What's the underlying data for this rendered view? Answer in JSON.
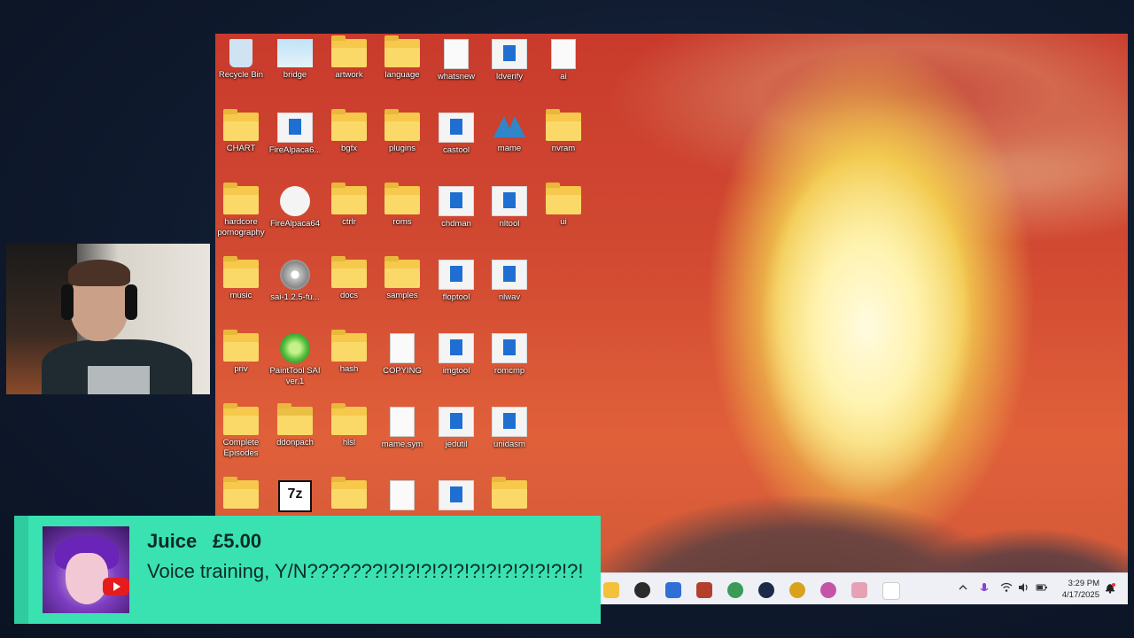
{
  "desktop": {
    "icons": [
      {
        "label": "Recycle Bin",
        "icon": "recycle-bin-icon"
      },
      {
        "label": "bridge",
        "icon": "image-file-icon"
      },
      {
        "label": "artwork",
        "icon": "folder-icon"
      },
      {
        "label": "language",
        "icon": "folder-icon"
      },
      {
        "label": "whatsnew",
        "icon": "document-icon"
      },
      {
        "label": "ldverify",
        "icon": "executable-icon"
      },
      {
        "label": "ai",
        "icon": "settings-file-icon"
      },
      {
        "label": "CHART",
        "icon": "folder-icon"
      },
      {
        "label": "FireAlpaca6...",
        "icon": "installer-icon"
      },
      {
        "label": "bgfx",
        "icon": "folder-icon"
      },
      {
        "label": "plugins",
        "icon": "folder-icon"
      },
      {
        "label": "castool",
        "icon": "executable-icon"
      },
      {
        "label": "mame",
        "icon": "mame-icon"
      },
      {
        "label": "nvram",
        "icon": "folder-icon"
      },
      {
        "label": "hardcore pornography",
        "icon": "folder-icon"
      },
      {
        "label": "FireAlpaca64",
        "icon": "firealpaca-icon"
      },
      {
        "label": "ctrlr",
        "icon": "folder-icon"
      },
      {
        "label": "roms",
        "icon": "folder-icon"
      },
      {
        "label": "chdman",
        "icon": "executable-icon"
      },
      {
        "label": "nltool",
        "icon": "executable-icon"
      },
      {
        "label": "ui",
        "icon": "folder-icon"
      },
      {
        "label": "music",
        "icon": "folder-icon"
      },
      {
        "label": "sai-1.2.5-fu...",
        "icon": "disc-installer-icon"
      },
      {
        "label": "docs",
        "icon": "folder-icon"
      },
      {
        "label": "samples",
        "icon": "folder-icon"
      },
      {
        "label": "floptool",
        "icon": "executable-icon"
      },
      {
        "label": "nlwav",
        "icon": "executable-icon"
      },
      {
        "label": "priv",
        "icon": "folder-icon"
      },
      {
        "label": "PaintTool SAI ver.1",
        "icon": "painttool-sai-icon"
      },
      {
        "label": "hash",
        "icon": "folder-icon"
      },
      {
        "label": "COPYING",
        "icon": "document-icon"
      },
      {
        "label": "imgtool",
        "icon": "executable-icon"
      },
      {
        "label": "romcmp",
        "icon": "executable-icon"
      },
      {
        "label": "Complete Episodes",
        "icon": "folder-icon"
      },
      {
        "label": "ddonpach",
        "icon": "zip-folder-icon"
      },
      {
        "label": "hlsl",
        "icon": "folder-icon"
      },
      {
        "label": "mame.sym",
        "icon": "document-icon"
      },
      {
        "label": "jedutil",
        "icon": "executable-icon"
      },
      {
        "label": "unidasm",
        "icon": "executable-icon"
      },
      {
        "label": "",
        "icon": "folder-icon"
      },
      {
        "label": "",
        "icon": "7zip-icon"
      },
      {
        "label": "",
        "icon": "folder-icon"
      },
      {
        "label": "",
        "icon": "document-icon"
      },
      {
        "label": "",
        "icon": "executable-icon"
      },
      {
        "label": "",
        "icon": "folder-icon"
      }
    ]
  },
  "taskbar": {
    "apps": [
      {
        "name": "file-explorer-icon",
        "color": "#f3c23a"
      },
      {
        "name": "obs-icon",
        "color": "#2b2b2b"
      },
      {
        "name": "notepad-icon",
        "color": "#2f6fd6"
      },
      {
        "name": "game-app-icon",
        "color": "#b3402c"
      },
      {
        "name": "browser-icon",
        "color": "#3b9a57"
      },
      {
        "name": "steam-icon",
        "color": "#1b2a47"
      },
      {
        "name": "media-app-icon",
        "color": "#d8a21d"
      },
      {
        "name": "paint-app-icon",
        "color": "#c455a6"
      },
      {
        "name": "character-app-icon",
        "color": "#e6a2b4"
      },
      {
        "name": "document-app-icon",
        "color": "#ffffff"
      }
    ],
    "tray": {
      "time": "3:29 PM",
      "date": "4/17/2025"
    }
  },
  "alert": {
    "name": "Juice",
    "amount": "£5.00",
    "message": "Voice training, Y/N???????!?!?!?!?!?!?!?!?!?!?!?!?!",
    "accent": "#3ae2b2",
    "platform": "youtube-icon"
  }
}
